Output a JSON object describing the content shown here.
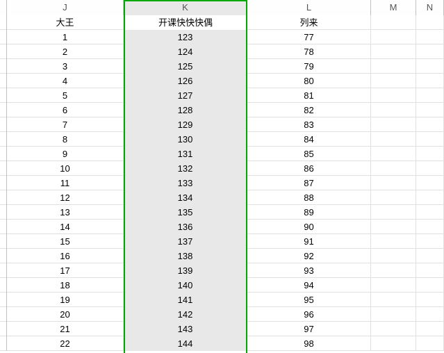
{
  "columns": {
    "J": "J",
    "K": "K",
    "L": "L",
    "M": "M",
    "N": "N"
  },
  "headerRow": {
    "J": "大王",
    "K": "开课快快快偶",
    "L": "列来",
    "M": "",
    "N": ""
  },
  "rows": [
    {
      "J": "1",
      "K": "123",
      "L": "77",
      "M": "",
      "N": ""
    },
    {
      "J": "2",
      "K": "124",
      "L": "78",
      "M": "",
      "N": ""
    },
    {
      "J": "3",
      "K": "125",
      "L": "79",
      "M": "",
      "N": ""
    },
    {
      "J": "4",
      "K": "126",
      "L": "80",
      "M": "",
      "N": ""
    },
    {
      "J": "5",
      "K": "127",
      "L": "81",
      "M": "",
      "N": ""
    },
    {
      "J": "6",
      "K": "128",
      "L": "82",
      "M": "",
      "N": ""
    },
    {
      "J": "7",
      "K": "129",
      "L": "83",
      "M": "",
      "N": ""
    },
    {
      "J": "8",
      "K": "130",
      "L": "84",
      "M": "",
      "N": ""
    },
    {
      "J": "9",
      "K": "131",
      "L": "85",
      "M": "",
      "N": ""
    },
    {
      "J": "10",
      "K": "132",
      "L": "86",
      "M": "",
      "N": ""
    },
    {
      "J": "11",
      "K": "133",
      "L": "87",
      "M": "",
      "N": ""
    },
    {
      "J": "12",
      "K": "134",
      "L": "88",
      "M": "",
      "N": ""
    },
    {
      "J": "13",
      "K": "135",
      "L": "89",
      "M": "",
      "N": ""
    },
    {
      "J": "14",
      "K": "136",
      "L": "90",
      "M": "",
      "N": ""
    },
    {
      "J": "15",
      "K": "137",
      "L": "91",
      "M": "",
      "N": ""
    },
    {
      "J": "16",
      "K": "138",
      "L": "92",
      "M": "",
      "N": ""
    },
    {
      "J": "17",
      "K": "139",
      "L": "93",
      "M": "",
      "N": ""
    },
    {
      "J": "18",
      "K": "140",
      "L": "94",
      "M": "",
      "N": ""
    },
    {
      "J": "19",
      "K": "141",
      "L": "95",
      "M": "",
      "N": ""
    },
    {
      "J": "20",
      "K": "142",
      "L": "96",
      "M": "",
      "N": ""
    },
    {
      "J": "21",
      "K": "143",
      "L": "97",
      "M": "",
      "N": ""
    },
    {
      "J": "22",
      "K": "144",
      "L": "98",
      "M": "",
      "N": ""
    }
  ],
  "selection": {
    "selectedColumn": "K",
    "activeCellValue": "开课快快快偶",
    "selectionColor": "#00a800"
  }
}
